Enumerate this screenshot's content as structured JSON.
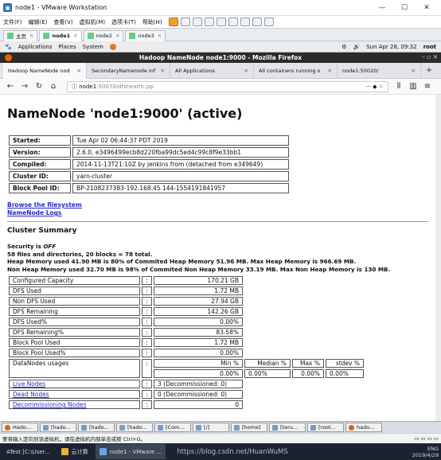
{
  "vmware": {
    "title": "node1 - VMware Workstation",
    "menu": [
      "文件(F)",
      "编辑(E)",
      "查看(V)",
      "虚拟机(M)",
      "选项卡(T)",
      "帮助(H)"
    ],
    "tabs": [
      {
        "label": "主页"
      },
      {
        "label": "node1",
        "active": true
      },
      {
        "label": "node2"
      },
      {
        "label": "node3"
      }
    ],
    "status_hint": "要将输入定向到该虚拟机，请在虚拟机内部单击或按 Ctrl+G。"
  },
  "gnome": {
    "applications": "Applications",
    "places": "Places",
    "system": "System",
    "clock": "Sun Apr 28, 09:32",
    "user": "root"
  },
  "firefox": {
    "window_title": "Hadoop NameNode node1:9000 - Mozilla Firefox",
    "window_controls": "– ▫ ✕",
    "tabs": [
      {
        "label": "Hadoop NameNode nod",
        "active": true
      },
      {
        "label": "SecondaryNamenode inf"
      },
      {
        "label": "All Applications"
      },
      {
        "label": "All containers running o"
      },
      {
        "label": "node1:50020/"
      }
    ],
    "url_host": "node1",
    "url_path": ":50070/dfshealth.jsp",
    "url_more": "···"
  },
  "page": {
    "heading": "NameNode 'node1:9000' (active)",
    "info": [
      {
        "key": "Started:",
        "value": "Tue Apr 02 06:44:37 PDT 2019"
      },
      {
        "key": "Version:",
        "value": "2.6.0, e3496499ecb8d220fba99dc5ed4c99c8f9e33bb1"
      },
      {
        "key": "Compiled:",
        "value": "2014-11-13T21:10Z by jenkins from (detached from e349649)"
      },
      {
        "key": "Cluster ID:",
        "value": "yarn-cluster"
      },
      {
        "key": "Block Pool ID:",
        "value": "BP-2108237383-192.168.45.144-1554191841957"
      }
    ],
    "browse_link": "Browse the filesystem",
    "logs_link": "NameNode Logs",
    "cluster_summary": "Cluster Summary",
    "security_prefix": "Security is ",
    "security_state": "OFF",
    "files_line": "58 files and directories, 20 blocks = 78 total.",
    "heap_line": "Heap Memory used 41.90 MB is 80% of Commited Heap Memory 51.96 MB. Max Heap Memory is 966.69 MB.",
    "nonheap_line": "Non Heap Memory used 32.70 MB is 98% of Commited Non Heap Memory 33.19 MB. Max Non Heap Memory is 130 MB.",
    "summary_rows": [
      {
        "label": "Configured Capacity",
        "value": "170.21 GB"
      },
      {
        "label": "DFS Used",
        "value": "1.72 MB"
      },
      {
        "label": "Non DFS Used",
        "value": "27.94 GB"
      },
      {
        "label": "DFS Remaining",
        "value": "142.26 GB"
      },
      {
        "label": "DFS Used%",
        "value": "0.00%"
      },
      {
        "label": "DFS Remaining%",
        "value": "83.58%"
      },
      {
        "label": "Block Pool Used",
        "value": "1.72 MB"
      },
      {
        "label": "Block Pool Used%",
        "value": "0.00%"
      }
    ],
    "datanodes_label": "DataNodes usages",
    "datanodes_headers": [
      "Min %",
      "Median %",
      "Max %",
      "stdev %"
    ],
    "datanodes_values": [
      "0.00%",
      "0.00%",
      "0.00%",
      "0.00%"
    ],
    "node_rows": [
      {
        "label": "Live Nodes",
        "value": "3 (Decommissioned: 0)"
      },
      {
        "label": "Dead Nodes",
        "value": "0 (Decommissioned: 0)"
      },
      {
        "label": "Decommissioning Nodes",
        "value": "0"
      }
    ],
    "sep": ":"
  },
  "guest_taskbar": [
    "Hado...",
    "[hado...",
    "[hado...",
    "[hado...",
    "[Com...",
    "[/]",
    "[home]",
    "[teru...",
    "[root...",
    "hado..."
  ],
  "host_taskbar": {
    "items": [
      "ATest [C:\\User...",
      "云计算",
      "node1 - VMware ..."
    ],
    "lang": "ENG",
    "watermark": "https://blog.csdn.net/HuanWuMS",
    "date": "2019/4/29"
  }
}
